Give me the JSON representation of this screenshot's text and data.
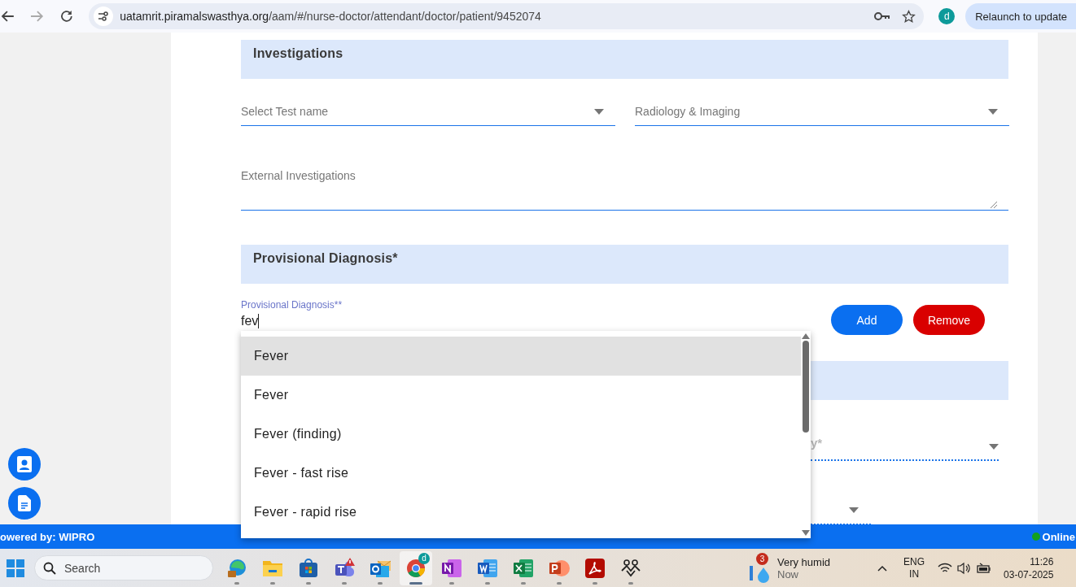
{
  "browser": {
    "url_host": "uatamrit.piramalswasthya.org",
    "url_path": "/aam/#/nurse-doctor/attendant/doctor/patient/9452074",
    "profile_initial": "d",
    "relaunch": "Relaunch to update"
  },
  "investigations": {
    "title": "Investigations",
    "test_select": {
      "placeholder": "Select Test name"
    },
    "radiology_select": {
      "placeholder": "Radiology & Imaging"
    },
    "external": {
      "placeholder": "External Investigations"
    }
  },
  "diagnosis": {
    "title": "Provisional Diagnosis*",
    "field_label": "Provisional Diagnosis**",
    "value": "fev",
    "add": "Add",
    "remove": "Remove"
  },
  "suggestions": [
    {
      "label": "Fever",
      "selected": true
    },
    {
      "label": "Fever",
      "selected": false
    },
    {
      "label": "Fever (finding)",
      "selected": false
    },
    {
      "label": "Fever - fast rise",
      "selected": false
    },
    {
      "label": "Fever - rapid rise",
      "selected": false
    }
  ],
  "covered_section": {
    "field_label": "y*"
  },
  "footer": {
    "powered": "owered by: WIPRO",
    "status": "Online"
  },
  "taskbar": {
    "search": {
      "placeholder": "Search"
    },
    "apps": [
      {
        "kind": "edge",
        "selected": false
      },
      {
        "kind": "files",
        "selected": false
      },
      {
        "kind": "store",
        "selected": false
      },
      {
        "kind": "teams",
        "selected": false
      },
      {
        "kind": "outlook",
        "selected": false
      },
      {
        "kind": "chrome",
        "selected": true,
        "badge": "d"
      },
      {
        "kind": "onenote",
        "selected": false
      },
      {
        "kind": "word",
        "selected": false
      },
      {
        "kind": "excel",
        "selected": false
      },
      {
        "kind": "powerpoint",
        "selected": false
      },
      {
        "kind": "acrobat",
        "selected": false
      },
      {
        "kind": "connect",
        "selected": false
      }
    ],
    "weather": {
      "badge": "3",
      "condition": "Very humid",
      "when": "Now"
    },
    "language": {
      "lang": "ENG",
      "region": "IN"
    },
    "time": "11:26",
    "date": "03-07-2025"
  }
}
